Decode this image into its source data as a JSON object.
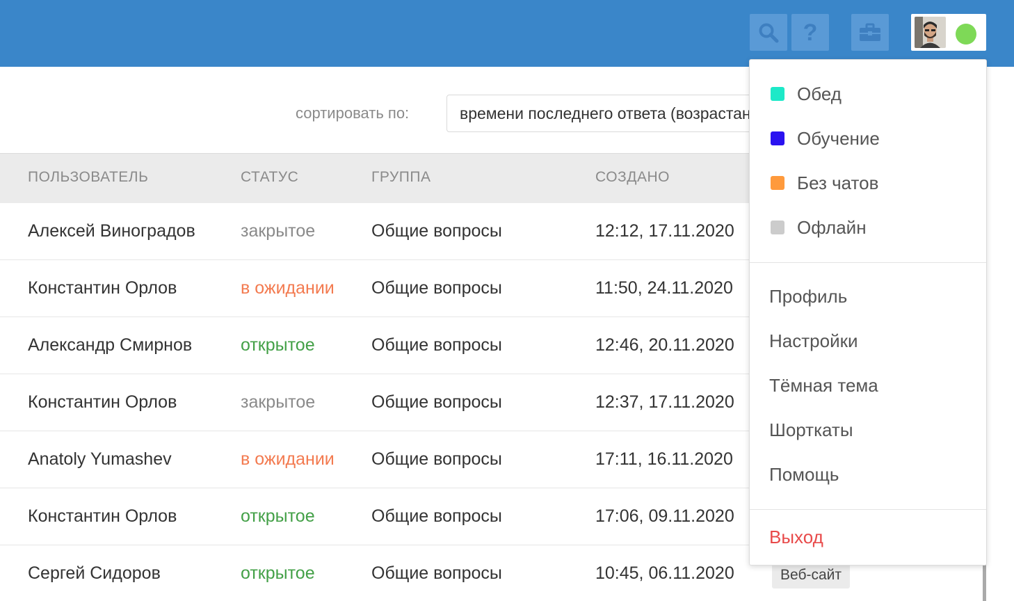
{
  "topbar": {
    "color": "#3a86c9",
    "buttons": [
      {
        "name": "search-icon"
      },
      {
        "name": "help-icon",
        "glyph": "?"
      },
      {
        "name": "briefcase-icon"
      }
    ],
    "user": {
      "avatar": "user-avatar",
      "status_color": "#7ed957"
    }
  },
  "sort": {
    "label": "сортировать по:",
    "value": "времени последнего ответа (возрастание)"
  },
  "table": {
    "columns": [
      "ПОЛЬЗОВАТЕЛЬ",
      "СТАТУС",
      "ГРУППА",
      "СОЗДАНО"
    ],
    "rows": [
      {
        "user": "Алексей Виноградов",
        "status": "закрытое",
        "status_kind": "closed",
        "group": "Общие вопросы",
        "created": "12:12, 17.11.2020"
      },
      {
        "user": "Константин Орлов",
        "status": "в ожидании",
        "status_kind": "waiting",
        "group": "Общие вопросы",
        "created": "11:50, 24.11.2020"
      },
      {
        "user": "Александр Смирнов",
        "status": "открытое",
        "status_kind": "open",
        "group": "Общие вопросы",
        "created": "12:46, 20.11.2020"
      },
      {
        "user": "Константин Орлов",
        "status": "закрытое",
        "status_kind": "closed",
        "group": "Общие вопросы",
        "created": "12:37, 17.11.2020"
      },
      {
        "user": "Anatoly Yumashev",
        "status": "в ожидании",
        "status_kind": "waiting",
        "group": "Общие вопросы",
        "created": "17:11, 16.11.2020"
      },
      {
        "user": "Константин Орлов",
        "status": "открытое",
        "status_kind": "open",
        "group": "Общие вопросы",
        "created": "17:06, 09.11.2020"
      },
      {
        "user": "Сергей Сидоров",
        "status": "открытое",
        "status_kind": "open",
        "group": "Общие вопросы",
        "created": "10:45, 06.11.2020",
        "channel": "Веб-сайт"
      }
    ],
    "status_colors": {
      "closed": "#8a8a8a",
      "waiting": "#f37a4f",
      "open": "#43a047"
    }
  },
  "dropdown": {
    "statuses": [
      {
        "label": "Обед",
        "color": "#1de9c8"
      },
      {
        "label": "Обучение",
        "color": "#2a12f0"
      },
      {
        "label": "Без чатов",
        "color": "#ff9a3c"
      },
      {
        "label": "Офлайн",
        "color": "#cccccc"
      }
    ],
    "items": [
      "Профиль",
      "Настройки",
      "Тёмная тема",
      "Шорткаты",
      "Помощь"
    ],
    "logout": "Выход"
  }
}
